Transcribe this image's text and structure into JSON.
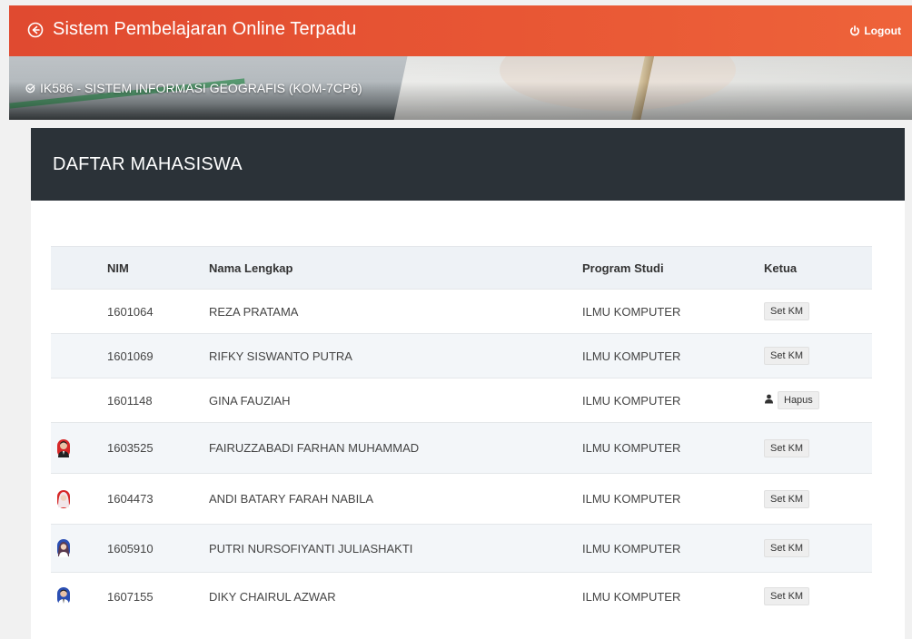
{
  "header": {
    "title": "Sistem Pembelajaran Online Terpadu",
    "logout_label": "Logout",
    "accent": "#e8553a"
  },
  "banner": {
    "course": "IK586 - SISTEM INFORMASI GEOGRAFIS (KOM-7CP6)"
  },
  "card": {
    "title": "DAFTAR MAHASISWA",
    "header_bg": "#2b3238"
  },
  "table": {
    "columns": [
      "NIM",
      "Nama Lengkap",
      "Program Studi",
      "Ketua"
    ],
    "rows": [
      {
        "nim": "1601064",
        "name": "REZA PRATAMA",
        "prodi": "ILMU KOMPUTER",
        "action": "Set KM",
        "photo": "none"
      },
      {
        "nim": "1601069",
        "name": "RIFKY SISWANTO PUTRA",
        "prodi": "ILMU KOMPUTER",
        "action": "Set KM",
        "photo": "none"
      },
      {
        "nim": "1601148",
        "name": "GINA FAUZIAH",
        "prodi": "ILMU KOMPUTER",
        "action": "Hapus",
        "photo": "none",
        "is_leader": true
      },
      {
        "nim": "1603525",
        "name": "FAIRUZZABADI FARHAN MUHAMMAD",
        "prodi": "ILMU KOMPUTER",
        "action": "Set KM",
        "photo": "red-background-photo"
      },
      {
        "nim": "1604473",
        "name": "ANDI BATARY FARAH NABILA",
        "prodi": "ILMU KOMPUTER",
        "action": "Set KM",
        "photo": "red-background-photo"
      },
      {
        "nim": "1605910",
        "name": "PUTRI NURSOFIYANTI JULIASHAKTI",
        "prodi": "ILMU KOMPUTER",
        "action": "Set KM",
        "photo": "blue-background-photo"
      },
      {
        "nim": "1607155",
        "name": "DIKY CHAIRUL AZWAR",
        "prodi": "ILMU KOMPUTER",
        "action": "Set KM",
        "photo": "blue-background-photo"
      }
    ]
  }
}
